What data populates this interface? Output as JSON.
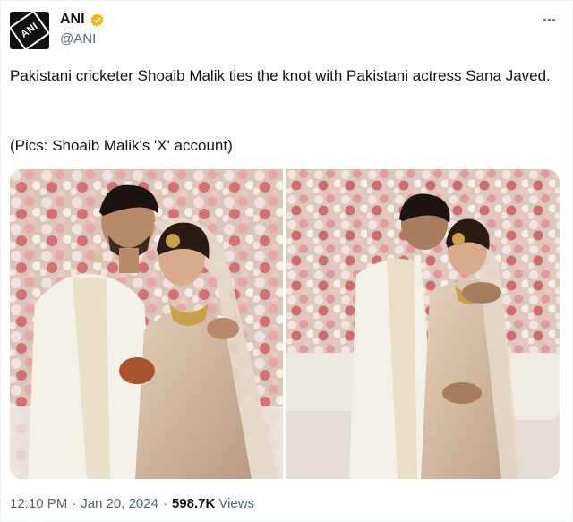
{
  "author": {
    "display_name": "ANI",
    "handle": "@ANI",
    "avatar_text": "ANI",
    "avatar_icon": "ani-logo-icon",
    "verified_icon": "verified-badge-icon",
    "verified_color": "#f4b400"
  },
  "tweet": {
    "text": "Pakistani cricketer Shoaib Malik ties the knot with Pakistani actress Sana Javed.",
    "caption": "(Pics: Shoaib Malik's 'X' account)"
  },
  "media": [
    {
      "name": "wedding-photo-1"
    },
    {
      "name": "wedding-photo-2"
    }
  ],
  "meta": {
    "time": "12:10 PM",
    "separator": "·",
    "date": "Jan 20, 2024",
    "views_count": "598.7K",
    "views_label": "Views"
  },
  "more_icon": "more-options-icon"
}
